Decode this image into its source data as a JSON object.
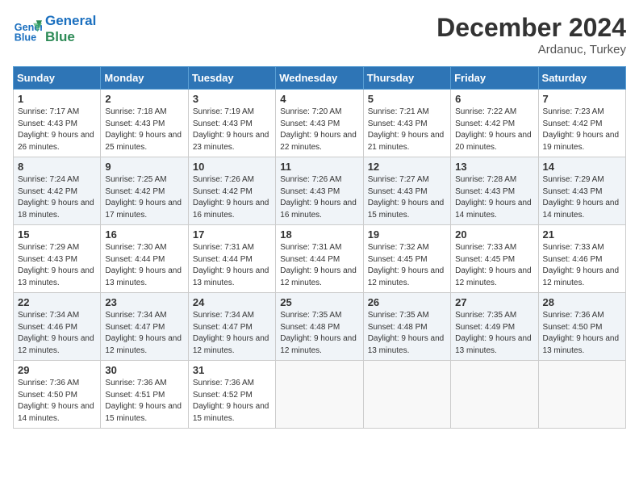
{
  "header": {
    "logo_line1": "General",
    "logo_line2": "Blue",
    "month": "December 2024",
    "location": "Ardanuc, Turkey"
  },
  "weekdays": [
    "Sunday",
    "Monday",
    "Tuesday",
    "Wednesday",
    "Thursday",
    "Friday",
    "Saturday"
  ],
  "weeks": [
    [
      {
        "day": "1",
        "sunrise": "7:17 AM",
        "sunset": "4:43 PM",
        "daylight": "9 hours and 26 minutes."
      },
      {
        "day": "2",
        "sunrise": "7:18 AM",
        "sunset": "4:43 PM",
        "daylight": "9 hours and 25 minutes."
      },
      {
        "day": "3",
        "sunrise": "7:19 AM",
        "sunset": "4:43 PM",
        "daylight": "9 hours and 23 minutes."
      },
      {
        "day": "4",
        "sunrise": "7:20 AM",
        "sunset": "4:43 PM",
        "daylight": "9 hours and 22 minutes."
      },
      {
        "day": "5",
        "sunrise": "7:21 AM",
        "sunset": "4:43 PM",
        "daylight": "9 hours and 21 minutes."
      },
      {
        "day": "6",
        "sunrise": "7:22 AM",
        "sunset": "4:42 PM",
        "daylight": "9 hours and 20 minutes."
      },
      {
        "day": "7",
        "sunrise": "7:23 AM",
        "sunset": "4:42 PM",
        "daylight": "9 hours and 19 minutes."
      }
    ],
    [
      {
        "day": "8",
        "sunrise": "7:24 AM",
        "sunset": "4:42 PM",
        "daylight": "9 hours and 18 minutes."
      },
      {
        "day": "9",
        "sunrise": "7:25 AM",
        "sunset": "4:42 PM",
        "daylight": "9 hours and 17 minutes."
      },
      {
        "day": "10",
        "sunrise": "7:26 AM",
        "sunset": "4:42 PM",
        "daylight": "9 hours and 16 minutes."
      },
      {
        "day": "11",
        "sunrise": "7:26 AM",
        "sunset": "4:43 PM",
        "daylight": "9 hours and 16 minutes."
      },
      {
        "day": "12",
        "sunrise": "7:27 AM",
        "sunset": "4:43 PM",
        "daylight": "9 hours and 15 minutes."
      },
      {
        "day": "13",
        "sunrise": "7:28 AM",
        "sunset": "4:43 PM",
        "daylight": "9 hours and 14 minutes."
      },
      {
        "day": "14",
        "sunrise": "7:29 AM",
        "sunset": "4:43 PM",
        "daylight": "9 hours and 14 minutes."
      }
    ],
    [
      {
        "day": "15",
        "sunrise": "7:29 AM",
        "sunset": "4:43 PM",
        "daylight": "9 hours and 13 minutes."
      },
      {
        "day": "16",
        "sunrise": "7:30 AM",
        "sunset": "4:44 PM",
        "daylight": "9 hours and 13 minutes."
      },
      {
        "day": "17",
        "sunrise": "7:31 AM",
        "sunset": "4:44 PM",
        "daylight": "9 hours and 13 minutes."
      },
      {
        "day": "18",
        "sunrise": "7:31 AM",
        "sunset": "4:44 PM",
        "daylight": "9 hours and 12 minutes."
      },
      {
        "day": "19",
        "sunrise": "7:32 AM",
        "sunset": "4:45 PM",
        "daylight": "9 hours and 12 minutes."
      },
      {
        "day": "20",
        "sunrise": "7:33 AM",
        "sunset": "4:45 PM",
        "daylight": "9 hours and 12 minutes."
      },
      {
        "day": "21",
        "sunrise": "7:33 AM",
        "sunset": "4:46 PM",
        "daylight": "9 hours and 12 minutes."
      }
    ],
    [
      {
        "day": "22",
        "sunrise": "7:34 AM",
        "sunset": "4:46 PM",
        "daylight": "9 hours and 12 minutes."
      },
      {
        "day": "23",
        "sunrise": "7:34 AM",
        "sunset": "4:47 PM",
        "daylight": "9 hours and 12 minutes."
      },
      {
        "day": "24",
        "sunrise": "7:34 AM",
        "sunset": "4:47 PM",
        "daylight": "9 hours and 12 minutes."
      },
      {
        "day": "25",
        "sunrise": "7:35 AM",
        "sunset": "4:48 PM",
        "daylight": "9 hours and 12 minutes."
      },
      {
        "day": "26",
        "sunrise": "7:35 AM",
        "sunset": "4:48 PM",
        "daylight": "9 hours and 13 minutes."
      },
      {
        "day": "27",
        "sunrise": "7:35 AM",
        "sunset": "4:49 PM",
        "daylight": "9 hours and 13 minutes."
      },
      {
        "day": "28",
        "sunrise": "7:36 AM",
        "sunset": "4:50 PM",
        "daylight": "9 hours and 13 minutes."
      }
    ],
    [
      {
        "day": "29",
        "sunrise": "7:36 AM",
        "sunset": "4:50 PM",
        "daylight": "9 hours and 14 minutes."
      },
      {
        "day": "30",
        "sunrise": "7:36 AM",
        "sunset": "4:51 PM",
        "daylight": "9 hours and 15 minutes."
      },
      {
        "day": "31",
        "sunrise": "7:36 AM",
        "sunset": "4:52 PM",
        "daylight": "9 hours and 15 minutes."
      },
      null,
      null,
      null,
      null
    ]
  ]
}
